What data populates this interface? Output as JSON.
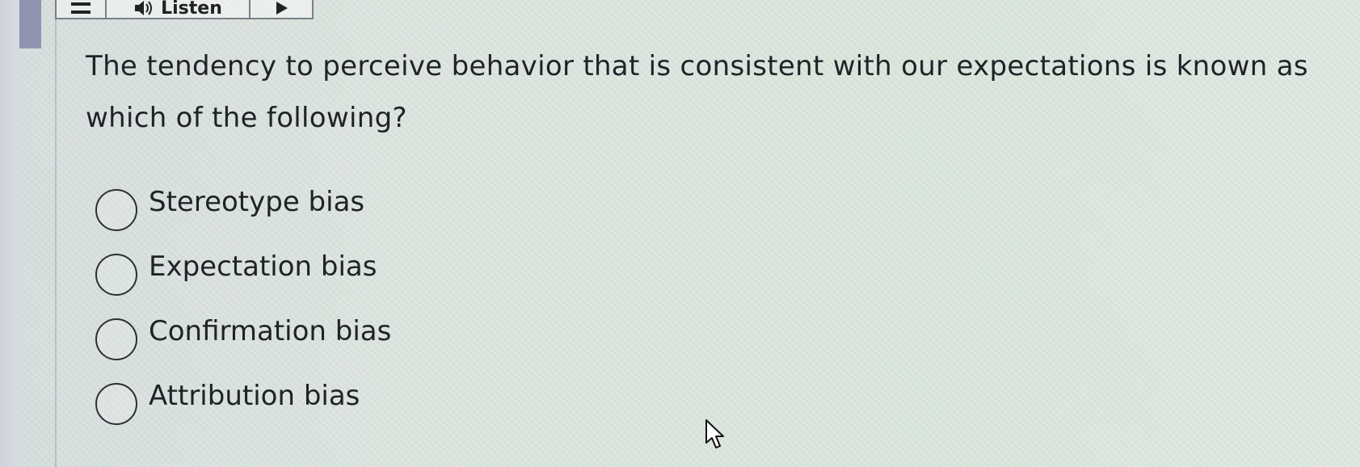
{
  "toolbar": {
    "listen_label": "Listen",
    "icons": [
      "menu-icon",
      "speaker-icon",
      "play-icon"
    ]
  },
  "question": {
    "text": "The tendency to perceive behavior that is consistent with our expectations is known as which of the following?"
  },
  "options": [
    {
      "label": "Stereotype bias",
      "selected": false
    },
    {
      "label": "Expectation bias",
      "selected": false
    },
    {
      "label": "Confirmation bias",
      "selected": false
    },
    {
      "label": "Attribution bias",
      "selected": false
    }
  ]
}
